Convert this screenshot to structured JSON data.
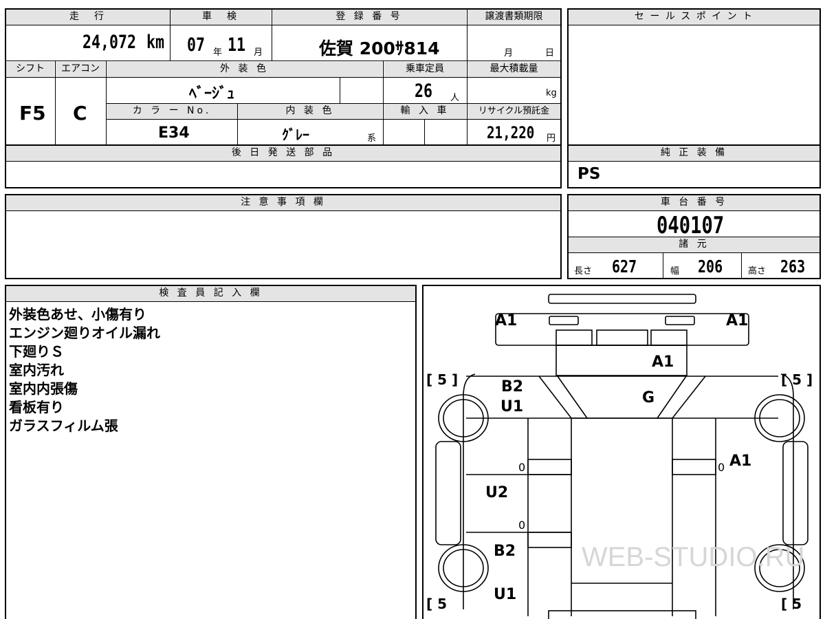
{
  "top": {
    "mileage_label": "走　行",
    "mileage_value": "24,072",
    "mileage_unit": "km",
    "inspection_label": "車　検",
    "inspection_year": "07",
    "inspection_year_unit": "年",
    "inspection_month": "11",
    "inspection_month_unit": "月",
    "registration_label": "登 録 番 号",
    "registration_value": "佐賀 200ｻ814",
    "transfer_deadline_label": "譲渡書類期限",
    "transfer_month_unit": "月",
    "transfer_day_unit": "日",
    "sales_point_label": "セ ー ル ス ポ イ ン ト"
  },
  "row2": {
    "shift_label": "シフト",
    "shift_value": "F5",
    "ac_label": "エアコン",
    "ac_value": "C",
    "exterior_color_label": "外 装 色",
    "exterior_color_value": "ﾍﾞｰｼﾞｭ",
    "capacity_label": "乗車定員",
    "capacity_value": "26",
    "capacity_unit": "人",
    "max_load_label": "最大積載量",
    "max_load_unit": "kg",
    "color_no_label": "カ ラ ー No.",
    "color_no_value": "E34",
    "interior_color_label": "内 装 色",
    "interior_color_value": "ｸﾞﾚｰ",
    "interior_color_suffix": "系",
    "import_label": "輸 入 車",
    "recycle_label": "リサイクル預託金",
    "recycle_value": "21,220",
    "recycle_unit": "円"
  },
  "later_parts_label": "後 日 発 送 部 品",
  "genuine_equipment": {
    "label": "純 正 装 備",
    "value": "PS"
  },
  "caution_label": "注 意 事 項 欄",
  "chassis": {
    "label": "車 台 番 号",
    "value": "040107",
    "specs_label": "諸 元",
    "length_label": "長さ",
    "length_value": "627",
    "width_label": "幅",
    "width_value": "206",
    "height_label": "高さ",
    "height_value": "263"
  },
  "inspector": {
    "label": "検 査 員 記 入 欄",
    "lines": [
      "外装色あせ、小傷有り",
      "エンジン廻りオイル漏れ",
      "下廻りＳ",
      "室内汚れ",
      "室内内張傷",
      "看板有り",
      "ガラスフィルム張"
    ]
  },
  "diagram": {
    "marks": {
      "front_left": "A1",
      "front_right": "A1",
      "front_center": "A1",
      "left_front": "B2",
      "left_front_under": "U1",
      "windshield": "G",
      "right_side": "A1",
      "left_middle": "U2",
      "left_rear": "B2",
      "left_rear_under": "U1",
      "zero_1": "0",
      "zero_2": "0",
      "zero_3": "0"
    },
    "tire_labels": [
      "[ 5 ]",
      "[ 5 ]",
      "[ 5",
      "[ 5"
    ],
    "watermark": "WEB-STUDIO.RU"
  }
}
